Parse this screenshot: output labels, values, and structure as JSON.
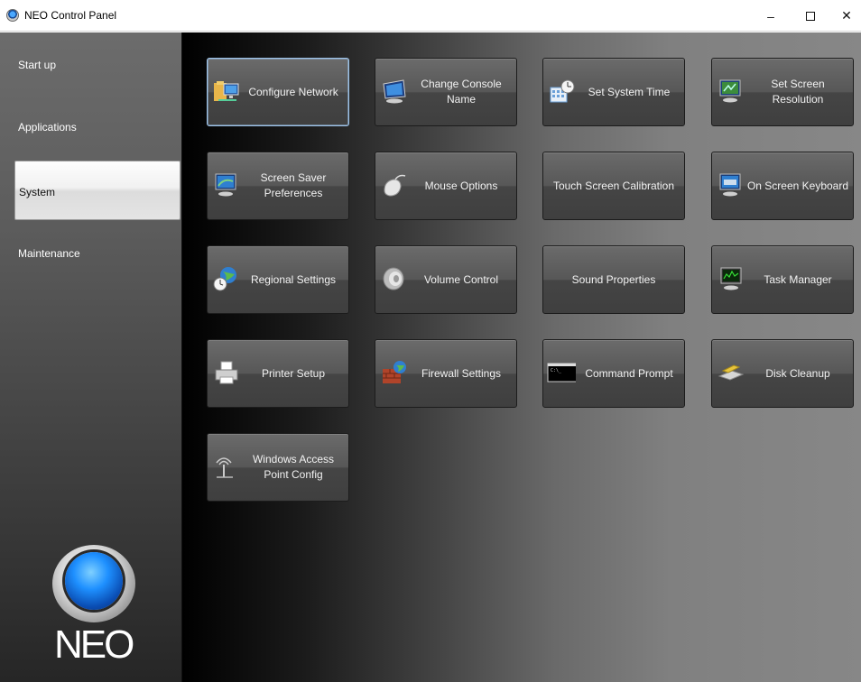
{
  "window": {
    "title": "NEO Control Panel",
    "controls": {
      "minimize": "–",
      "close": "✕"
    }
  },
  "sidebar": {
    "items": [
      {
        "label": "Start up",
        "selected": false
      },
      {
        "label": "Applications",
        "selected": false
      },
      {
        "label": "System",
        "selected": true
      },
      {
        "label": "Maintenance",
        "selected": false
      }
    ],
    "logo_text": "NEO"
  },
  "tiles": [
    {
      "label": "Configure Network",
      "icon": "network-folder-icon",
      "selected": true
    },
    {
      "label": "Change Console Name",
      "icon": "monitor-icon"
    },
    {
      "label": "Set System Time",
      "icon": "clock-calendar-icon"
    },
    {
      "label": "Set Screen Resolution",
      "icon": "screen-resolution-icon"
    },
    {
      "label": "Screen Saver Preferences",
      "icon": "screen-saver-icon"
    },
    {
      "label": "Mouse Options",
      "icon": "mouse-icon"
    },
    {
      "label": "Touch Screen Calibration",
      "icon": ""
    },
    {
      "label": "On Screen Keyboard",
      "icon": "keyboard-monitor-icon"
    },
    {
      "label": "Regional Settings",
      "icon": "globe-clock-icon"
    },
    {
      "label": "Volume Control",
      "icon": "speaker-icon"
    },
    {
      "label": "Sound Properties",
      "icon": ""
    },
    {
      "label": "Task Manager",
      "icon": "task-monitor-icon"
    },
    {
      "label": "Printer Setup",
      "icon": "printer-icon"
    },
    {
      "label": "Firewall Settings",
      "icon": "firewall-icon"
    },
    {
      "label": "Command Prompt",
      "icon": "command-prompt-icon"
    },
    {
      "label": "Disk Cleanup",
      "icon": "disk-cleanup-icon"
    },
    {
      "label": "Windows Access Point Config",
      "icon": "access-point-icon"
    }
  ],
  "colors": {
    "accent_blue": "#1e90ff",
    "tile_border_selected": "#9ec4ea"
  }
}
